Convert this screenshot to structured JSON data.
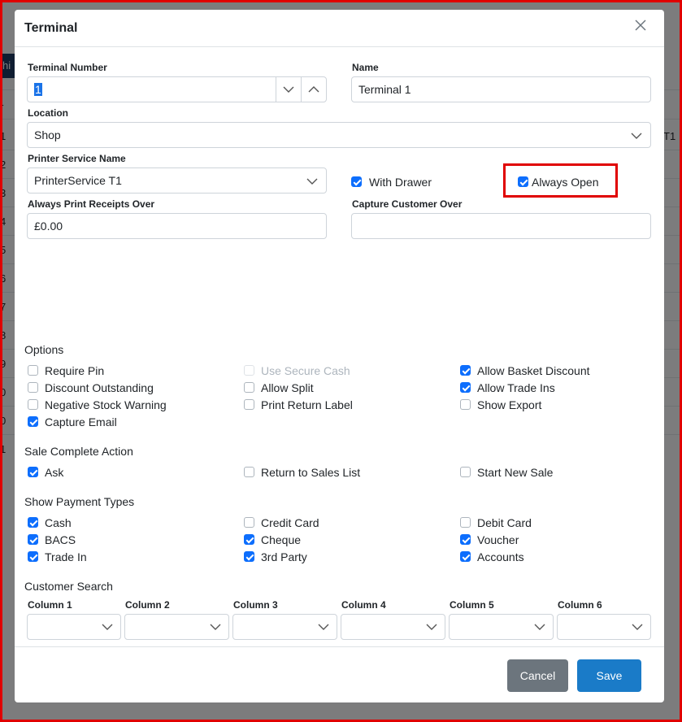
{
  "colors": {
    "accent": "#0d6efd",
    "highlight": "#e00000",
    "cancel": "#6c757d",
    "save": "#1a7bc8"
  },
  "background": {
    "tab_fragment": "hi",
    "col_fragment": "r",
    "rows": [
      "1",
      "2",
      "3",
      "4",
      "5",
      "6",
      "7",
      "8",
      "9",
      "0",
      "0",
      "1"
    ],
    "right_fragment": "T1"
  },
  "modal": {
    "title": "Terminal",
    "close_icon": "close-icon",
    "terminal_number": {
      "label": "Terminal Number",
      "value": "1"
    },
    "name": {
      "label": "Name",
      "value": "Terminal 1"
    },
    "location": {
      "label": "Location",
      "value": "Shop"
    },
    "printer_service": {
      "label": "Printer Service Name",
      "value": "PrinterService T1"
    },
    "with_drawer": {
      "label": "With Drawer",
      "checked": true
    },
    "always_open": {
      "label": "Always Open",
      "checked": true
    },
    "print_receipts": {
      "label": "Always Print Receipts Over",
      "value": "£0.00"
    },
    "capture_customer": {
      "label": "Capture Customer Over",
      "value": ""
    },
    "options": {
      "title": "Options",
      "items": [
        {
          "label": "Require Pin",
          "checked": false,
          "disabled": false
        },
        {
          "label": "Use Secure Cash",
          "checked": false,
          "disabled": true
        },
        {
          "label": "Allow Basket Discount",
          "checked": true,
          "disabled": false
        },
        {
          "label": "Discount Outstanding",
          "checked": false,
          "disabled": false
        },
        {
          "label": "Allow Split",
          "checked": false,
          "disabled": false
        },
        {
          "label": "Allow Trade Ins",
          "checked": true,
          "disabled": false
        },
        {
          "label": "Negative Stock Warning",
          "checked": false,
          "disabled": false
        },
        {
          "label": "Print Return Label",
          "checked": false,
          "disabled": false
        },
        {
          "label": "Show Export",
          "checked": false,
          "disabled": false
        },
        {
          "label": "Capture Email",
          "checked": true,
          "disabled": false
        }
      ]
    },
    "sale_complete": {
      "title": "Sale Complete Action",
      "items": [
        {
          "label": "Ask",
          "checked": true
        },
        {
          "label": "Return to Sales List",
          "checked": false
        },
        {
          "label": "Start New Sale",
          "checked": false
        }
      ]
    },
    "payment_types": {
      "title": "Show Payment Types",
      "items": [
        {
          "label": "Cash",
          "checked": true
        },
        {
          "label": "Credit Card",
          "checked": false
        },
        {
          "label": "Debit Card",
          "checked": false
        },
        {
          "label": "BACS",
          "checked": true
        },
        {
          "label": "Cheque",
          "checked": true
        },
        {
          "label": "Voucher",
          "checked": true
        },
        {
          "label": "Trade In",
          "checked": true
        },
        {
          "label": "3rd Party",
          "checked": true
        },
        {
          "label": "Accounts",
          "checked": true
        }
      ]
    },
    "customer_search": {
      "title": "Customer Search",
      "columns": [
        {
          "label": "Column 1",
          "value": ""
        },
        {
          "label": "Column 2",
          "value": ""
        },
        {
          "label": "Column 3",
          "value": ""
        },
        {
          "label": "Column 4",
          "value": ""
        },
        {
          "label": "Column 5",
          "value": ""
        },
        {
          "label": "Column 6",
          "value": ""
        }
      ]
    },
    "cancel_label": "Cancel",
    "save_label": "Save"
  }
}
